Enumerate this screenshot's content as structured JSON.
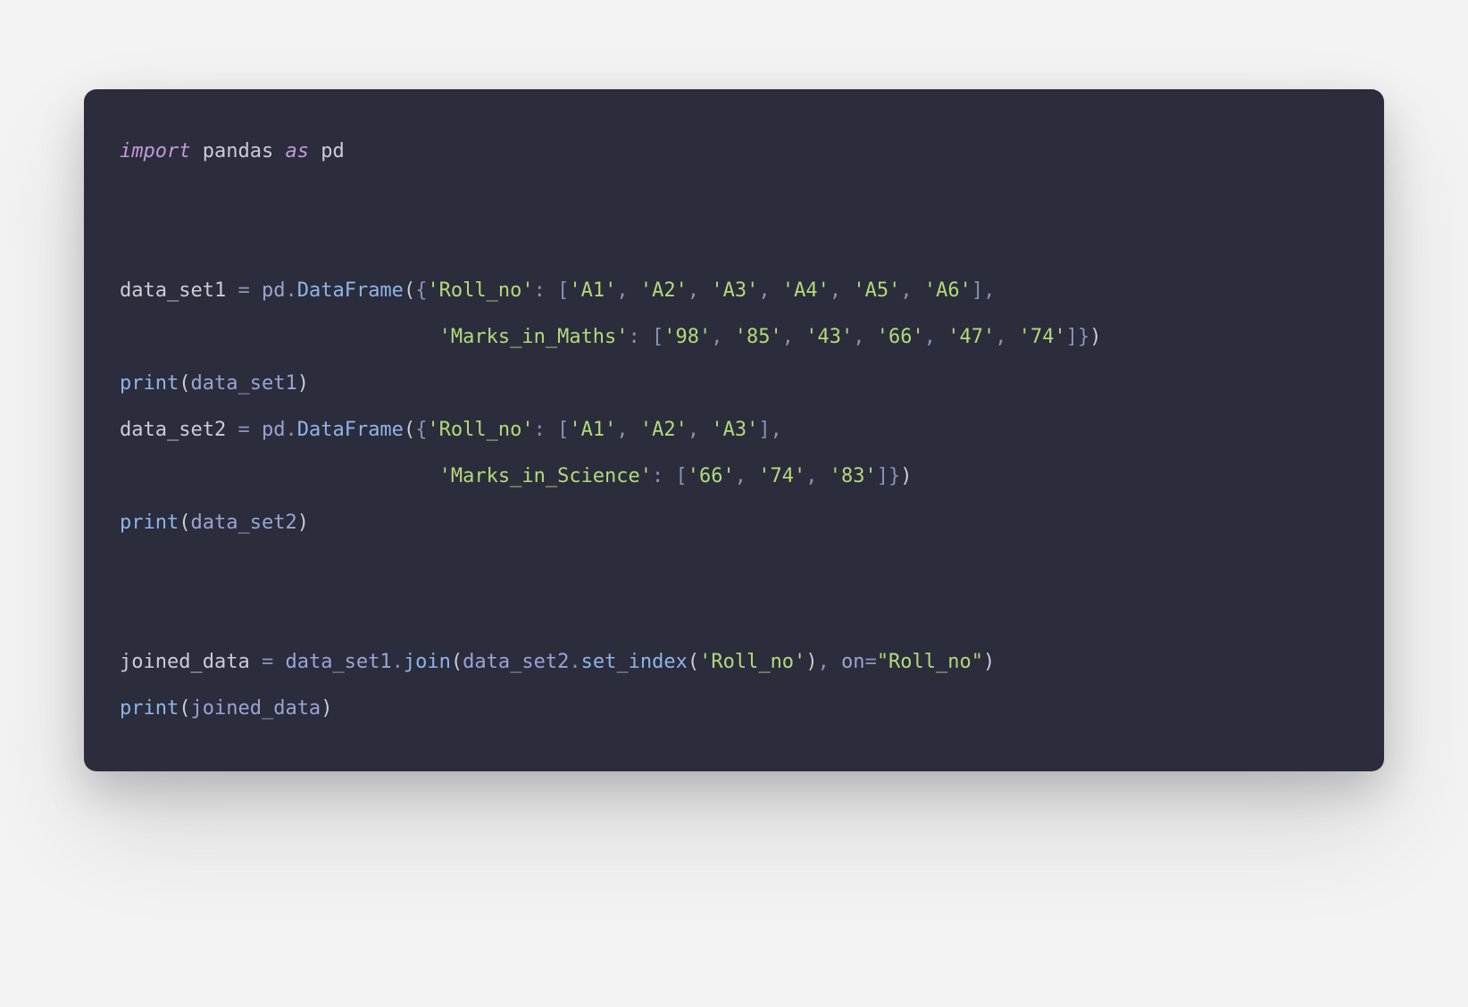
{
  "code": {
    "lines": [
      {
        "tokens": [
          {
            "t": "import",
            "c": "kw"
          },
          {
            "t": " ",
            "c": ""
          },
          {
            "t": "pandas",
            "c": "mod"
          },
          {
            "t": " ",
            "c": ""
          },
          {
            "t": "as",
            "c": "kw"
          },
          {
            "t": " ",
            "c": ""
          },
          {
            "t": "pd",
            "c": "mod"
          }
        ]
      },
      {
        "tokens": []
      },
      {
        "tokens": []
      },
      {
        "tokens": [
          {
            "t": "data_set1",
            "c": "var"
          },
          {
            "t": " ",
            "c": ""
          },
          {
            "t": "=",
            "c": "eq"
          },
          {
            "t": " ",
            "c": ""
          },
          {
            "t": "pd",
            "c": "id2"
          },
          {
            "t": ".",
            "c": "punct"
          },
          {
            "t": "DataFrame",
            "c": "fn"
          },
          {
            "t": "(",
            "c": "paren"
          },
          {
            "t": "{",
            "c": "brace"
          },
          {
            "t": "'Roll_no'",
            "c": "str"
          },
          {
            "t": ":",
            "c": "punct"
          },
          {
            "t": " ",
            "c": ""
          },
          {
            "t": "[",
            "c": "punct"
          },
          {
            "t": "'A1'",
            "c": "str"
          },
          {
            "t": ",",
            "c": "punct"
          },
          {
            "t": " ",
            "c": ""
          },
          {
            "t": "'A2'",
            "c": "str"
          },
          {
            "t": ",",
            "c": "punct"
          },
          {
            "t": " ",
            "c": ""
          },
          {
            "t": "'A3'",
            "c": "str"
          },
          {
            "t": ",",
            "c": "punct"
          },
          {
            "t": " ",
            "c": ""
          },
          {
            "t": "'A4'",
            "c": "str"
          },
          {
            "t": ",",
            "c": "punct"
          },
          {
            "t": " ",
            "c": ""
          },
          {
            "t": "'A5'",
            "c": "str"
          },
          {
            "t": ",",
            "c": "punct"
          },
          {
            "t": " ",
            "c": ""
          },
          {
            "t": "'A6'",
            "c": "str"
          },
          {
            "t": "]",
            "c": "punct"
          },
          {
            "t": ",",
            "c": "punct"
          }
        ]
      },
      {
        "tokens": [
          {
            "t": "                           ",
            "c": ""
          },
          {
            "t": "'Marks_in_Maths'",
            "c": "str"
          },
          {
            "t": ":",
            "c": "punct"
          },
          {
            "t": " ",
            "c": ""
          },
          {
            "t": "[",
            "c": "punct"
          },
          {
            "t": "'98'",
            "c": "str"
          },
          {
            "t": ",",
            "c": "punct"
          },
          {
            "t": " ",
            "c": ""
          },
          {
            "t": "'85'",
            "c": "str"
          },
          {
            "t": ",",
            "c": "punct"
          },
          {
            "t": " ",
            "c": ""
          },
          {
            "t": "'43'",
            "c": "str"
          },
          {
            "t": ",",
            "c": "punct"
          },
          {
            "t": " ",
            "c": ""
          },
          {
            "t": "'66'",
            "c": "str"
          },
          {
            "t": ",",
            "c": "punct"
          },
          {
            "t": " ",
            "c": ""
          },
          {
            "t": "'47'",
            "c": "str"
          },
          {
            "t": ",",
            "c": "punct"
          },
          {
            "t": " ",
            "c": ""
          },
          {
            "t": "'74'",
            "c": "str"
          },
          {
            "t": "]",
            "c": "punct"
          },
          {
            "t": "}",
            "c": "brace"
          },
          {
            "t": ")",
            "c": "paren"
          }
        ]
      },
      {
        "tokens": [
          {
            "t": "print",
            "c": "fn"
          },
          {
            "t": "(",
            "c": "paren"
          },
          {
            "t": "data_set1",
            "c": "id2"
          },
          {
            "t": ")",
            "c": "paren"
          }
        ]
      },
      {
        "tokens": [
          {
            "t": "data_set2",
            "c": "var"
          },
          {
            "t": " ",
            "c": ""
          },
          {
            "t": "=",
            "c": "eq"
          },
          {
            "t": " ",
            "c": ""
          },
          {
            "t": "pd",
            "c": "id2"
          },
          {
            "t": ".",
            "c": "punct"
          },
          {
            "t": "DataFrame",
            "c": "fn"
          },
          {
            "t": "(",
            "c": "paren"
          },
          {
            "t": "{",
            "c": "brace"
          },
          {
            "t": "'Roll_no'",
            "c": "str"
          },
          {
            "t": ":",
            "c": "punct"
          },
          {
            "t": " ",
            "c": ""
          },
          {
            "t": "[",
            "c": "punct"
          },
          {
            "t": "'A1'",
            "c": "str"
          },
          {
            "t": ",",
            "c": "punct"
          },
          {
            "t": " ",
            "c": ""
          },
          {
            "t": "'A2'",
            "c": "str"
          },
          {
            "t": ",",
            "c": "punct"
          },
          {
            "t": " ",
            "c": ""
          },
          {
            "t": "'A3'",
            "c": "str"
          },
          {
            "t": "]",
            "c": "punct"
          },
          {
            "t": ",",
            "c": "punct"
          }
        ]
      },
      {
        "tokens": [
          {
            "t": "                           ",
            "c": ""
          },
          {
            "t": "'Marks_in_Science'",
            "c": "str"
          },
          {
            "t": ":",
            "c": "punct"
          },
          {
            "t": " ",
            "c": ""
          },
          {
            "t": "[",
            "c": "punct"
          },
          {
            "t": "'66'",
            "c": "str"
          },
          {
            "t": ",",
            "c": "punct"
          },
          {
            "t": " ",
            "c": ""
          },
          {
            "t": "'74'",
            "c": "str"
          },
          {
            "t": ",",
            "c": "punct"
          },
          {
            "t": " ",
            "c": ""
          },
          {
            "t": "'83'",
            "c": "str"
          },
          {
            "t": "]",
            "c": "punct"
          },
          {
            "t": "}",
            "c": "brace"
          },
          {
            "t": ")",
            "c": "paren"
          }
        ]
      },
      {
        "tokens": [
          {
            "t": "print",
            "c": "fn"
          },
          {
            "t": "(",
            "c": "paren"
          },
          {
            "t": "data_set2",
            "c": "id2"
          },
          {
            "t": ")",
            "c": "paren"
          }
        ]
      },
      {
        "tokens": []
      },
      {
        "tokens": []
      },
      {
        "tokens": [
          {
            "t": "joined_data",
            "c": "var"
          },
          {
            "t": " ",
            "c": ""
          },
          {
            "t": "=",
            "c": "eq"
          },
          {
            "t": " ",
            "c": ""
          },
          {
            "t": "data_set1",
            "c": "id2"
          },
          {
            "t": ".",
            "c": "punct"
          },
          {
            "t": "join",
            "c": "fn"
          },
          {
            "t": "(",
            "c": "paren"
          },
          {
            "t": "data_set2",
            "c": "id2"
          },
          {
            "t": ".",
            "c": "punct"
          },
          {
            "t": "set_index",
            "c": "fn"
          },
          {
            "t": "(",
            "c": "paren"
          },
          {
            "t": "'Roll_no'",
            "c": "str"
          },
          {
            "t": ")",
            "c": "paren"
          },
          {
            "t": ",",
            "c": "punct"
          },
          {
            "t": " ",
            "c": ""
          },
          {
            "t": "on",
            "c": "id2"
          },
          {
            "t": "=",
            "c": "eq"
          },
          {
            "t": "\"Roll_no\"",
            "c": "str"
          },
          {
            "t": ")",
            "c": "paren"
          }
        ]
      },
      {
        "tokens": [
          {
            "t": "print",
            "c": "fn"
          },
          {
            "t": "(",
            "c": "paren"
          },
          {
            "t": "joined_data",
            "c": "id2"
          },
          {
            "t": ")",
            "c": "paren"
          }
        ]
      }
    ]
  }
}
